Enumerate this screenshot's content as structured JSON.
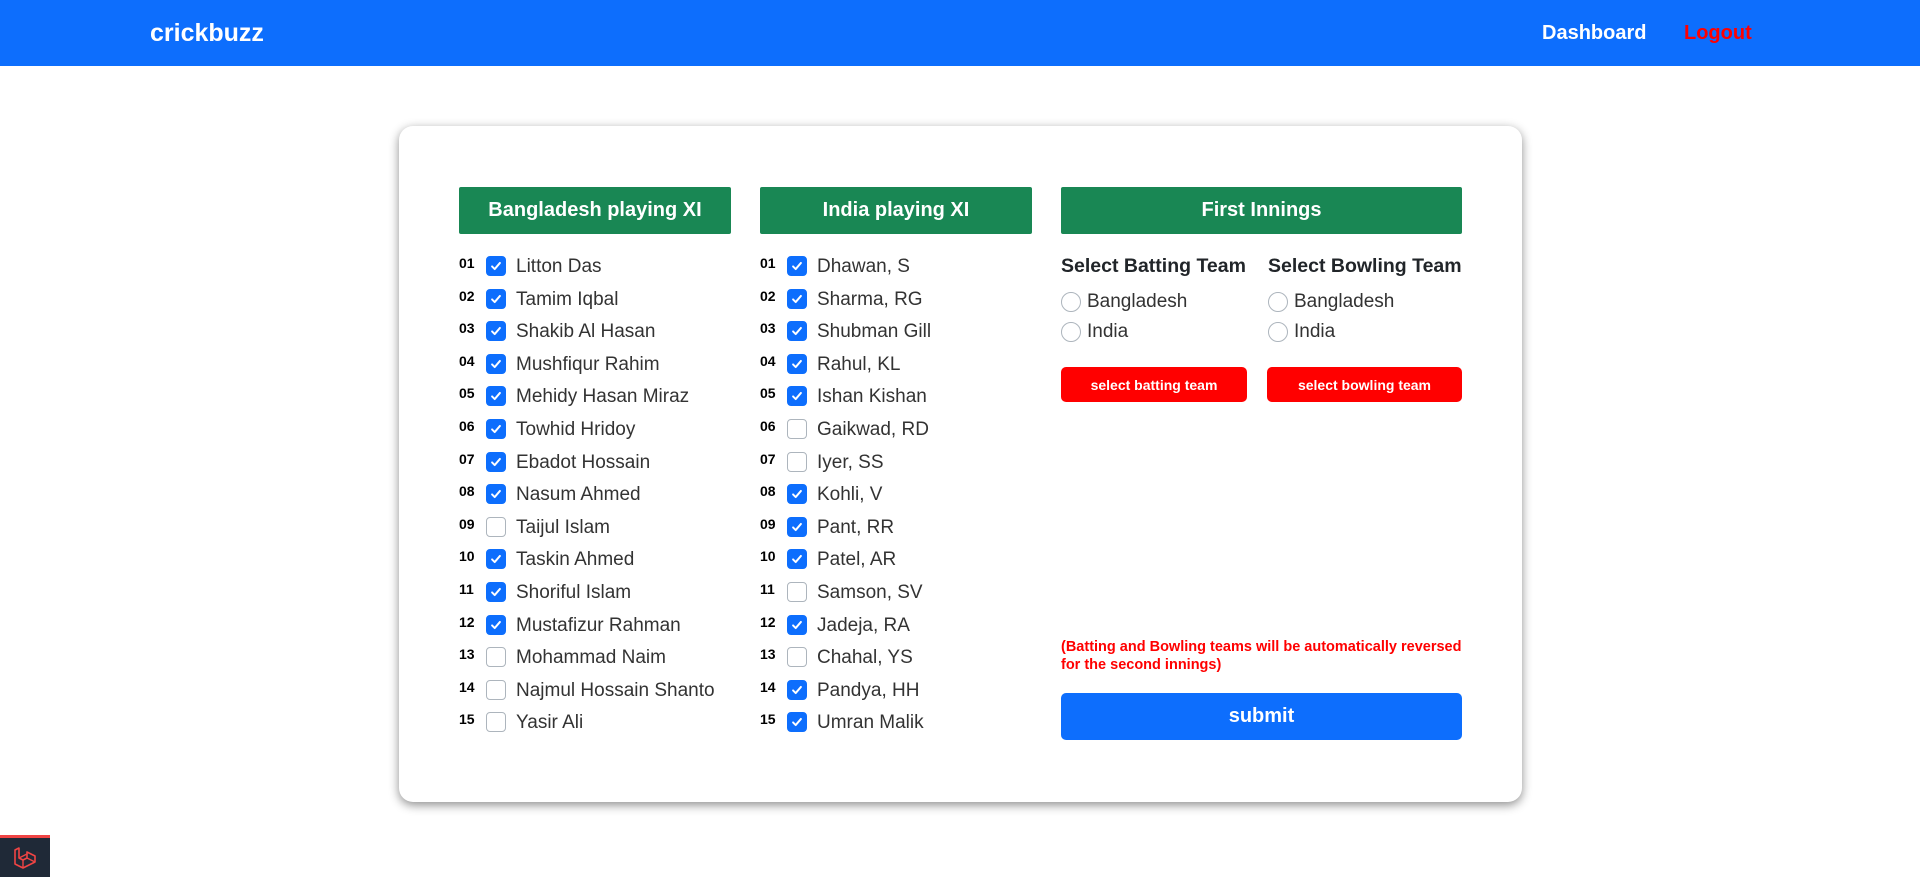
{
  "nav": {
    "brand": "crickbuzz",
    "dashboard": "Dashboard",
    "logout": "Logout"
  },
  "bangladesh": {
    "title": "Bangladesh playing XI",
    "players": [
      {
        "num": "01",
        "name": "Litton Das",
        "checked": true
      },
      {
        "num": "02",
        "name": "Tamim Iqbal",
        "checked": true
      },
      {
        "num": "03",
        "name": "Shakib Al Hasan",
        "checked": true
      },
      {
        "num": "04",
        "name": "Mushfiqur Rahim",
        "checked": true
      },
      {
        "num": "05",
        "name": "Mehidy Hasan Miraz",
        "checked": true
      },
      {
        "num": "06",
        "name": "Towhid Hridoy",
        "checked": true
      },
      {
        "num": "07",
        "name": "Ebadot Hossain",
        "checked": true
      },
      {
        "num": "08",
        "name": "Nasum Ahmed",
        "checked": true
      },
      {
        "num": "09",
        "name": "Taijul Islam",
        "checked": false
      },
      {
        "num": "10",
        "name": "Taskin Ahmed",
        "checked": true
      },
      {
        "num": "11",
        "name": "Shoriful Islam",
        "checked": true
      },
      {
        "num": "12",
        "name": "Mustafizur Rahman",
        "checked": true
      },
      {
        "num": "13",
        "name": "Mohammad Naim",
        "checked": false
      },
      {
        "num": "14",
        "name": "Najmul Hossain Shanto",
        "checked": false
      },
      {
        "num": "15",
        "name": "Yasir Ali",
        "checked": false
      }
    ]
  },
  "india": {
    "title": "India playing XI",
    "players": [
      {
        "num": "01",
        "name": "Dhawan, S",
        "checked": true
      },
      {
        "num": "02",
        "name": "Sharma, RG",
        "checked": true
      },
      {
        "num": "03",
        "name": "Shubman Gill",
        "checked": true
      },
      {
        "num": "04",
        "name": "Rahul, KL",
        "checked": true
      },
      {
        "num": "05",
        "name": "Ishan Kishan",
        "checked": true
      },
      {
        "num": "06",
        "name": "Gaikwad, RD",
        "checked": false
      },
      {
        "num": "07",
        "name": "Iyer, SS",
        "checked": false
      },
      {
        "num": "08",
        "name": "Kohli, V",
        "checked": true
      },
      {
        "num": "09",
        "name": "Pant, RR",
        "checked": true
      },
      {
        "num": "10",
        "name": "Patel, AR",
        "checked": true
      },
      {
        "num": "11",
        "name": "Samson, SV",
        "checked": false
      },
      {
        "num": "12",
        "name": "Jadeja, RA",
        "checked": true
      },
      {
        "num": "13",
        "name": "Chahal, YS",
        "checked": false
      },
      {
        "num": "14",
        "name": "Pandya, HH",
        "checked": true
      },
      {
        "num": "15",
        "name": "Umran Malik",
        "checked": true
      }
    ]
  },
  "innings": {
    "title": "First Innings",
    "batting": {
      "title": "Select Batting Team",
      "options": [
        "Bangladesh",
        "India"
      ],
      "button": "select batting team"
    },
    "bowling": {
      "title": "Select Bowling Team",
      "options": [
        "Bangladesh",
        "India"
      ],
      "button": "select bowling team"
    },
    "note": "(Batting and Bowling teams will be automatically reversed for the second innings)",
    "submit": "submit"
  },
  "colors": {
    "primary": "#0d6efd",
    "success": "#198754",
    "danger": "#ff0000"
  },
  "corner_badge_icon": "laravel-logo-icon"
}
